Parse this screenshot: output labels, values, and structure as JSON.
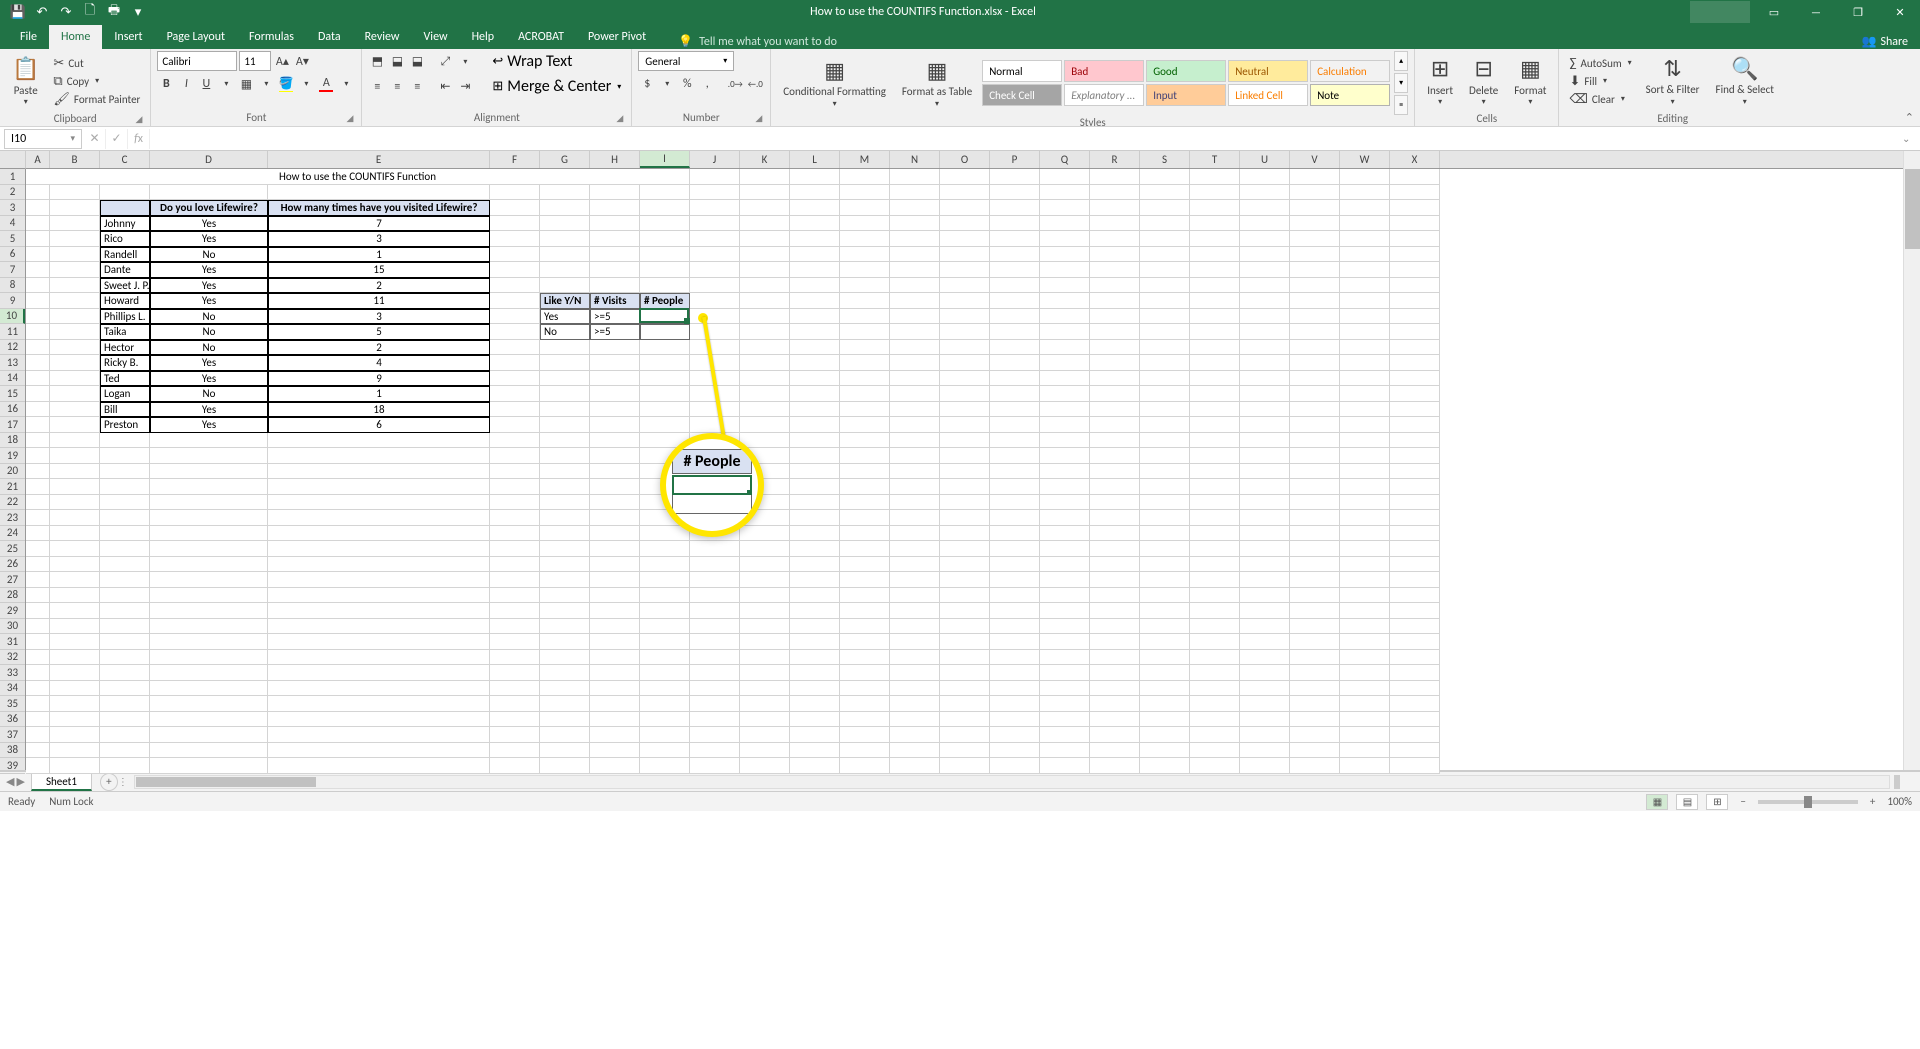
{
  "titlebar": {
    "filename": "How to use the COUNTIFS Function.xlsx - Excel",
    "qat": {
      "save": "💾",
      "undo": "↶",
      "redo": "↷",
      "new": "🗋",
      "print": "🖶"
    }
  },
  "win": {
    "min": "—",
    "restore": "❐",
    "close": "✕",
    "ribbon_opts": "▭"
  },
  "tabs": {
    "file": "File",
    "home": "Home",
    "insert": "Insert",
    "page_layout": "Page Layout",
    "formulas": "Formulas",
    "data": "Data",
    "review": "Review",
    "view": "View",
    "help": "Help",
    "acrobat": "ACROBAT",
    "power_pivot": "Power Pivot",
    "tell_me": "Tell me what you want to do",
    "share": "Share"
  },
  "ribbon": {
    "clipboard": {
      "label": "Clipboard",
      "paste": "Paste",
      "cut": "Cut",
      "copy": "Copy",
      "format_painter": "Format Painter"
    },
    "font": {
      "label": "Font",
      "name": "Calibri",
      "size": "11"
    },
    "alignment": {
      "label": "Alignment",
      "wrap": "Wrap Text",
      "merge": "Merge & Center"
    },
    "number": {
      "label": "Number",
      "format": "General"
    },
    "styles": {
      "label": "Styles",
      "conditional": "Conditional Formatting",
      "format_table": "Format as Table",
      "normal": "Normal",
      "bad": "Bad",
      "good": "Good",
      "neutral": "Neutral",
      "calculation": "Calculation",
      "check_cell": "Check Cell",
      "explanatory": "Explanatory ...",
      "input": "Input",
      "linked_cell": "Linked Cell",
      "note": "Note"
    },
    "cells": {
      "label": "Cells",
      "insert": "Insert",
      "delete": "Delete",
      "format": "Format"
    },
    "editing": {
      "label": "Editing",
      "autosum": "AutoSum",
      "fill": "Fill",
      "clear": "Clear",
      "sort": "Sort & Filter",
      "find": "Find & Select"
    }
  },
  "namebox": "I10",
  "sheet": {
    "title": "How to use the COUNTIFS Function",
    "headers": {
      "c": "",
      "d": "Do  you love Lifewire?",
      "e": "How many times have  you visited Lifewire?"
    },
    "rows": [
      {
        "name": "Johnny",
        "love": "Yes",
        "visits": "7"
      },
      {
        "name": "Rico",
        "love": "Yes",
        "visits": "3"
      },
      {
        "name": "Randell",
        "love": "No",
        "visits": "1"
      },
      {
        "name": "Dante",
        "love": "Yes",
        "visits": "15"
      },
      {
        "name": "Sweet J. P.",
        "love": "Yes",
        "visits": "2"
      },
      {
        "name": "Howard",
        "love": "Yes",
        "visits": "11"
      },
      {
        "name": "Phillips L.",
        "love": "No",
        "visits": "3"
      },
      {
        "name": "Taika",
        "love": "No",
        "visits": "5"
      },
      {
        "name": "Hector",
        "love": "No",
        "visits": "2"
      },
      {
        "name": "Ricky B.",
        "love": "Yes",
        "visits": "4"
      },
      {
        "name": "Ted",
        "love": "Yes",
        "visits": "9"
      },
      {
        "name": "Logan",
        "love": "No",
        "visits": "1"
      },
      {
        "name": "Bill",
        "love": "Yes",
        "visits": "18"
      },
      {
        "name": "Preston",
        "love": "Yes",
        "visits": "6"
      }
    ],
    "criteria": {
      "headers": {
        "like": "Like Y/N",
        "visits": "# Visits",
        "people": "# People"
      },
      "rows": [
        {
          "like": "Yes",
          "visits": ">=5",
          "people": ""
        },
        {
          "like": "No",
          "visits": ">=5",
          "people": ""
        }
      ]
    }
  },
  "callout": {
    "label": "# People"
  },
  "cols": [
    "A",
    "B",
    "C",
    "D",
    "E",
    "F",
    "G",
    "H",
    "I",
    "J",
    "K",
    "L",
    "M",
    "N",
    "O",
    "P",
    "Q",
    "R",
    "S",
    "T",
    "U",
    "V",
    "W",
    "X"
  ],
  "sheet_tabs": {
    "sheet1": "Sheet1"
  },
  "status": {
    "ready": "Ready",
    "numlock": "Num Lock",
    "zoom": "100%"
  }
}
